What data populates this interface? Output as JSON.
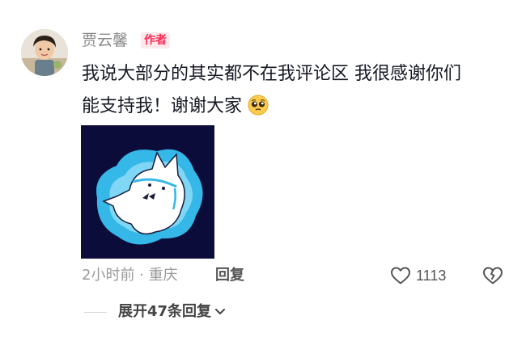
{
  "comment": {
    "username": "贾云馨",
    "author_badge": "作者",
    "text_line1": "我说大部分的其实都不在我评论区 我很感谢你们",
    "text_line2": "能支持我！谢谢大家",
    "emoji": "pleading-face-icon",
    "time_location": "2小时前 · 重庆",
    "reply_label": "回复",
    "like_count": "1113",
    "expand_replies": "展开47条回复"
  },
  "colors": {
    "badge_text": "#fe2c55",
    "badge_bg": "#fde8ec",
    "image_bg": "#0b0c3a",
    "sticker_blue": "#35b7e8"
  }
}
